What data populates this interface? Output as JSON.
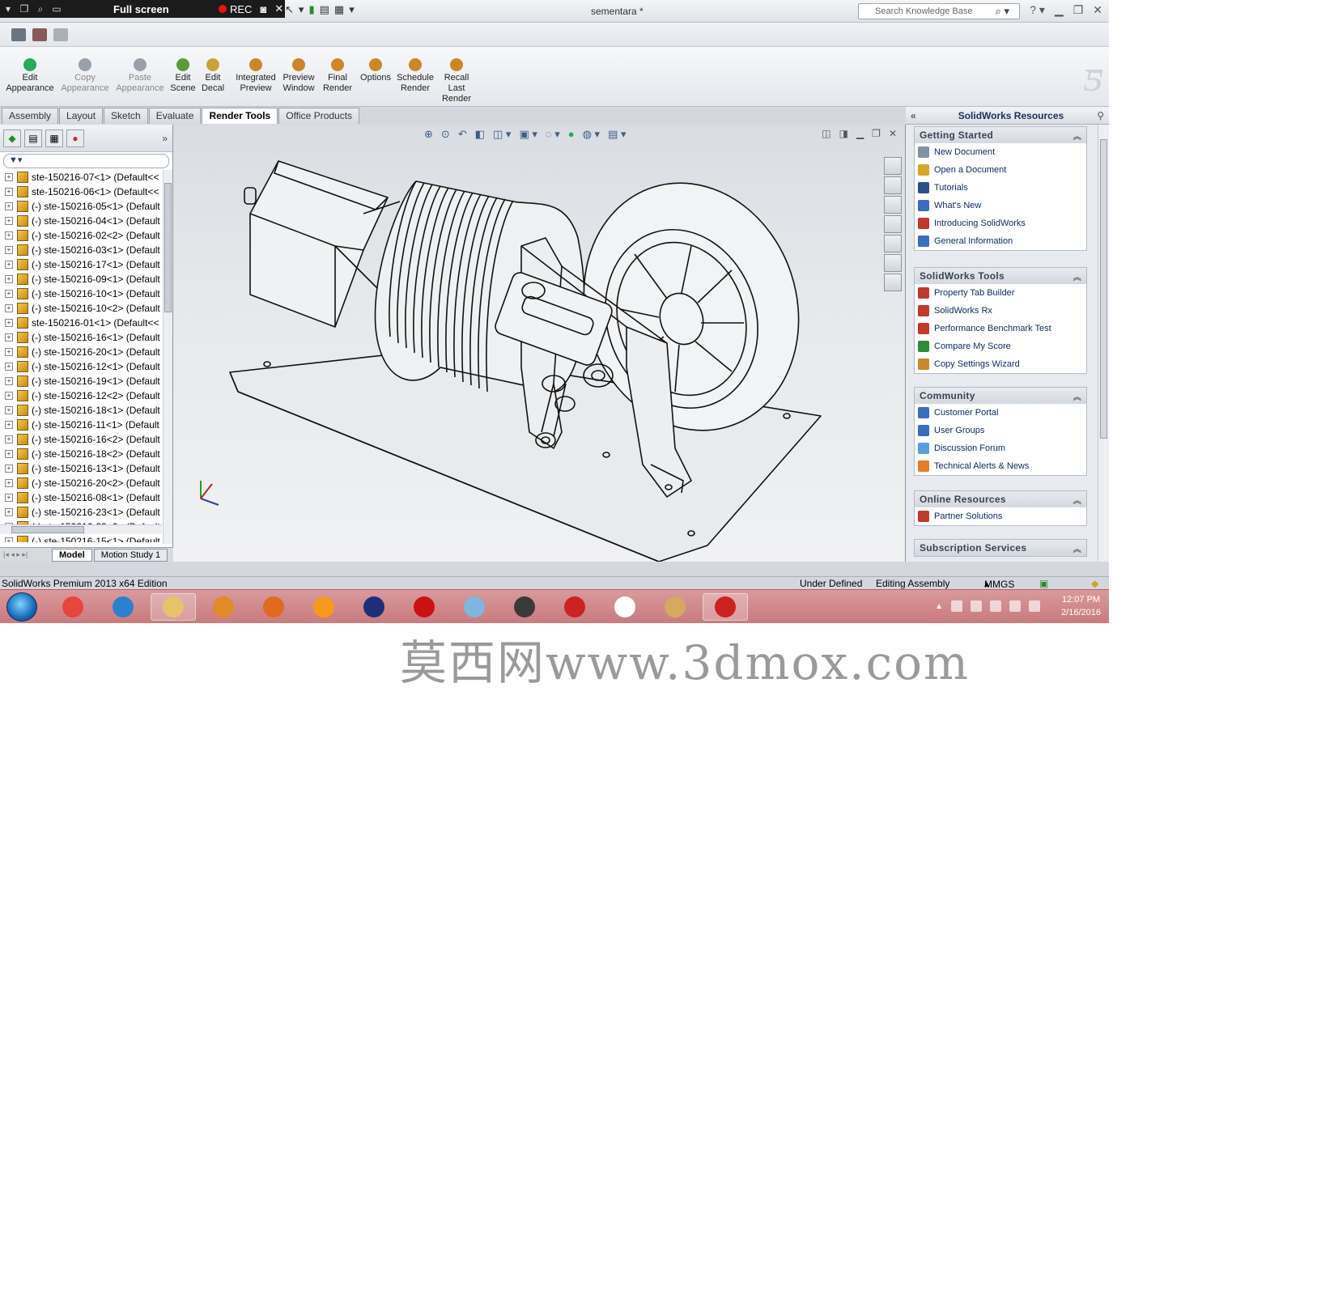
{
  "titlebar": {
    "recorder_mode": "Full screen",
    "recorder_rec": "REC",
    "document_title": "sementara *",
    "search_placeholder": "Search Knowledge Base"
  },
  "ribbon": {
    "buttons": [
      {
        "label": "Edit Appearance",
        "color": "#2aa85b"
      },
      {
        "label": "Copy Appearance",
        "color": "#9aa0a8"
      },
      {
        "label": "Paste Appearance",
        "color": "#9aa0a8"
      },
      {
        "label": "Edit Scene",
        "color": "#5a9a3a"
      },
      {
        "label": "Edit Decal",
        "color": "#caa23a"
      },
      {
        "label": "Integrated Preview",
        "color": "#c9862a"
      },
      {
        "label": "Preview Window",
        "color": "#c9862a"
      },
      {
        "label": "Final Render",
        "color": "#d0852a"
      },
      {
        "label": "Options",
        "color": "#c9862a"
      },
      {
        "label": "Schedule Render",
        "color": "#c9862a"
      },
      {
        "label": "Recall Last Render",
        "color": "#c9862a"
      }
    ]
  },
  "tabs": [
    "Assembly",
    "Layout",
    "Sketch",
    "Evaluate",
    "Render Tools",
    "Office Products"
  ],
  "active_tab": "Render Tools",
  "tree": {
    "items": [
      "ste-150216-07<1> (Default<<",
      "ste-150216-06<1> (Default<<",
      "(-) ste-150216-05<1> (Default",
      "(-) ste-150216-04<1> (Default",
      "(-) ste-150216-02<2> (Default",
      "(-) ste-150216-03<1> (Default",
      "(-) ste-150216-17<1> (Default",
      "(-) ste-150216-09<1> (Default",
      "(-) ste-150216-10<1> (Default",
      "(-) ste-150216-10<2> (Default",
      "ste-150216-01<1> (Default<<",
      "(-) ste-150216-16<1> (Default",
      "(-) ste-150216-20<1> (Default",
      "(-) ste-150216-12<1> (Default",
      "(-) ste-150216-19<1> (Default",
      "(-) ste-150216-12<2> (Default",
      "(-) ste-150216-18<1> (Default",
      "(-) ste-150216-11<1> (Default",
      "(-) ste-150216-16<2> (Default",
      "(-) ste-150216-18<2> (Default",
      "(-) ste-150216-13<1> (Default",
      "(-) ste-150216-20<2> (Default",
      "(-) ste-150216-08<1> (Default",
      "(-) ste-150216-23<1> (Default",
      "(-) ste-150216-23<2> (Default",
      "(-) ste-150216-15<1> (Default"
    ]
  },
  "bottom_tabs": [
    "Model",
    "Motion Study 1"
  ],
  "taskpane": {
    "title": "SolidWorks Resources",
    "sections": [
      {
        "title": "Getting Started",
        "items": [
          {
            "label": "New Document",
            "color": "#8090a8"
          },
          {
            "label": "Open a Document",
            "color": "#d6a52a"
          },
          {
            "label": "Tutorials",
            "color": "#2d4f8a"
          },
          {
            "label": "What's New",
            "color": "#3a6cc0"
          },
          {
            "label": "Introducing SolidWorks",
            "color": "#c0392b"
          },
          {
            "label": "General Information",
            "color": "#3a6cc0"
          }
        ]
      },
      {
        "title": "SolidWorks Tools",
        "items": [
          {
            "label": "Property Tab Builder",
            "color": "#c0392b"
          },
          {
            "label": "SolidWorks Rx",
            "color": "#c0392b"
          },
          {
            "label": "Performance Benchmark Test",
            "color": "#c0392b"
          },
          {
            "label": "Compare My Score",
            "color": "#2e8b3a"
          },
          {
            "label": "Copy Settings Wizard",
            "color": "#c9862a"
          }
        ]
      },
      {
        "title": "Community",
        "items": [
          {
            "label": "Customer Portal",
            "color": "#3a6cc0"
          },
          {
            "label": "User Groups",
            "color": "#3a6cc0"
          },
          {
            "label": "Discussion Forum",
            "color": "#5aa0d8"
          },
          {
            "label": "Technical Alerts & News",
            "color": "#e67e22"
          }
        ]
      },
      {
        "title": "Online Resources",
        "items": [
          {
            "label": "Partner Solutions",
            "color": "#c0392b"
          }
        ]
      },
      {
        "title": "Subscription Services",
        "items": []
      }
    ]
  },
  "status": {
    "edition": "SolidWorks Premium 2013 x64 Edition",
    "state": "Under Defined",
    "mode": "Editing Assembly",
    "units": "MMGS"
  },
  "taskbar": {
    "apps": [
      {
        "name": "chrome",
        "color": "#e8453c",
        "open": false
      },
      {
        "name": "internet-explorer",
        "color": "#2d7fd0",
        "open": false
      },
      {
        "name": "file-explorer",
        "color": "#e6c36a",
        "open": true
      },
      {
        "name": "media-player",
        "color": "#e08a2a",
        "open": false
      },
      {
        "name": "firefox",
        "color": "#e06a1f",
        "open": false
      },
      {
        "name": "orange-ball",
        "color": "#f59a1a",
        "open": false
      },
      {
        "name": "flag-app",
        "color": "#1d2f7a",
        "open": false
      },
      {
        "name": "recorder",
        "color": "#cc1111",
        "open": false
      },
      {
        "name": "blue-cube",
        "color": "#7fb6e0",
        "open": false
      },
      {
        "name": "clapper",
        "color": "#3a3a3a",
        "open": false
      },
      {
        "name": "solidworks",
        "color": "#cc2222",
        "open": false
      },
      {
        "name": "blank-document",
        "color": "#ffffff",
        "open": false
      },
      {
        "name": "paint",
        "color": "#d6a860",
        "open": false
      },
      {
        "name": "solidworks-active",
        "color": "#cc2222",
        "open": true
      }
    ],
    "time": "12:07 PM",
    "date": "2/16/2016"
  },
  "watermark": "莫西网www.3dmox.com"
}
